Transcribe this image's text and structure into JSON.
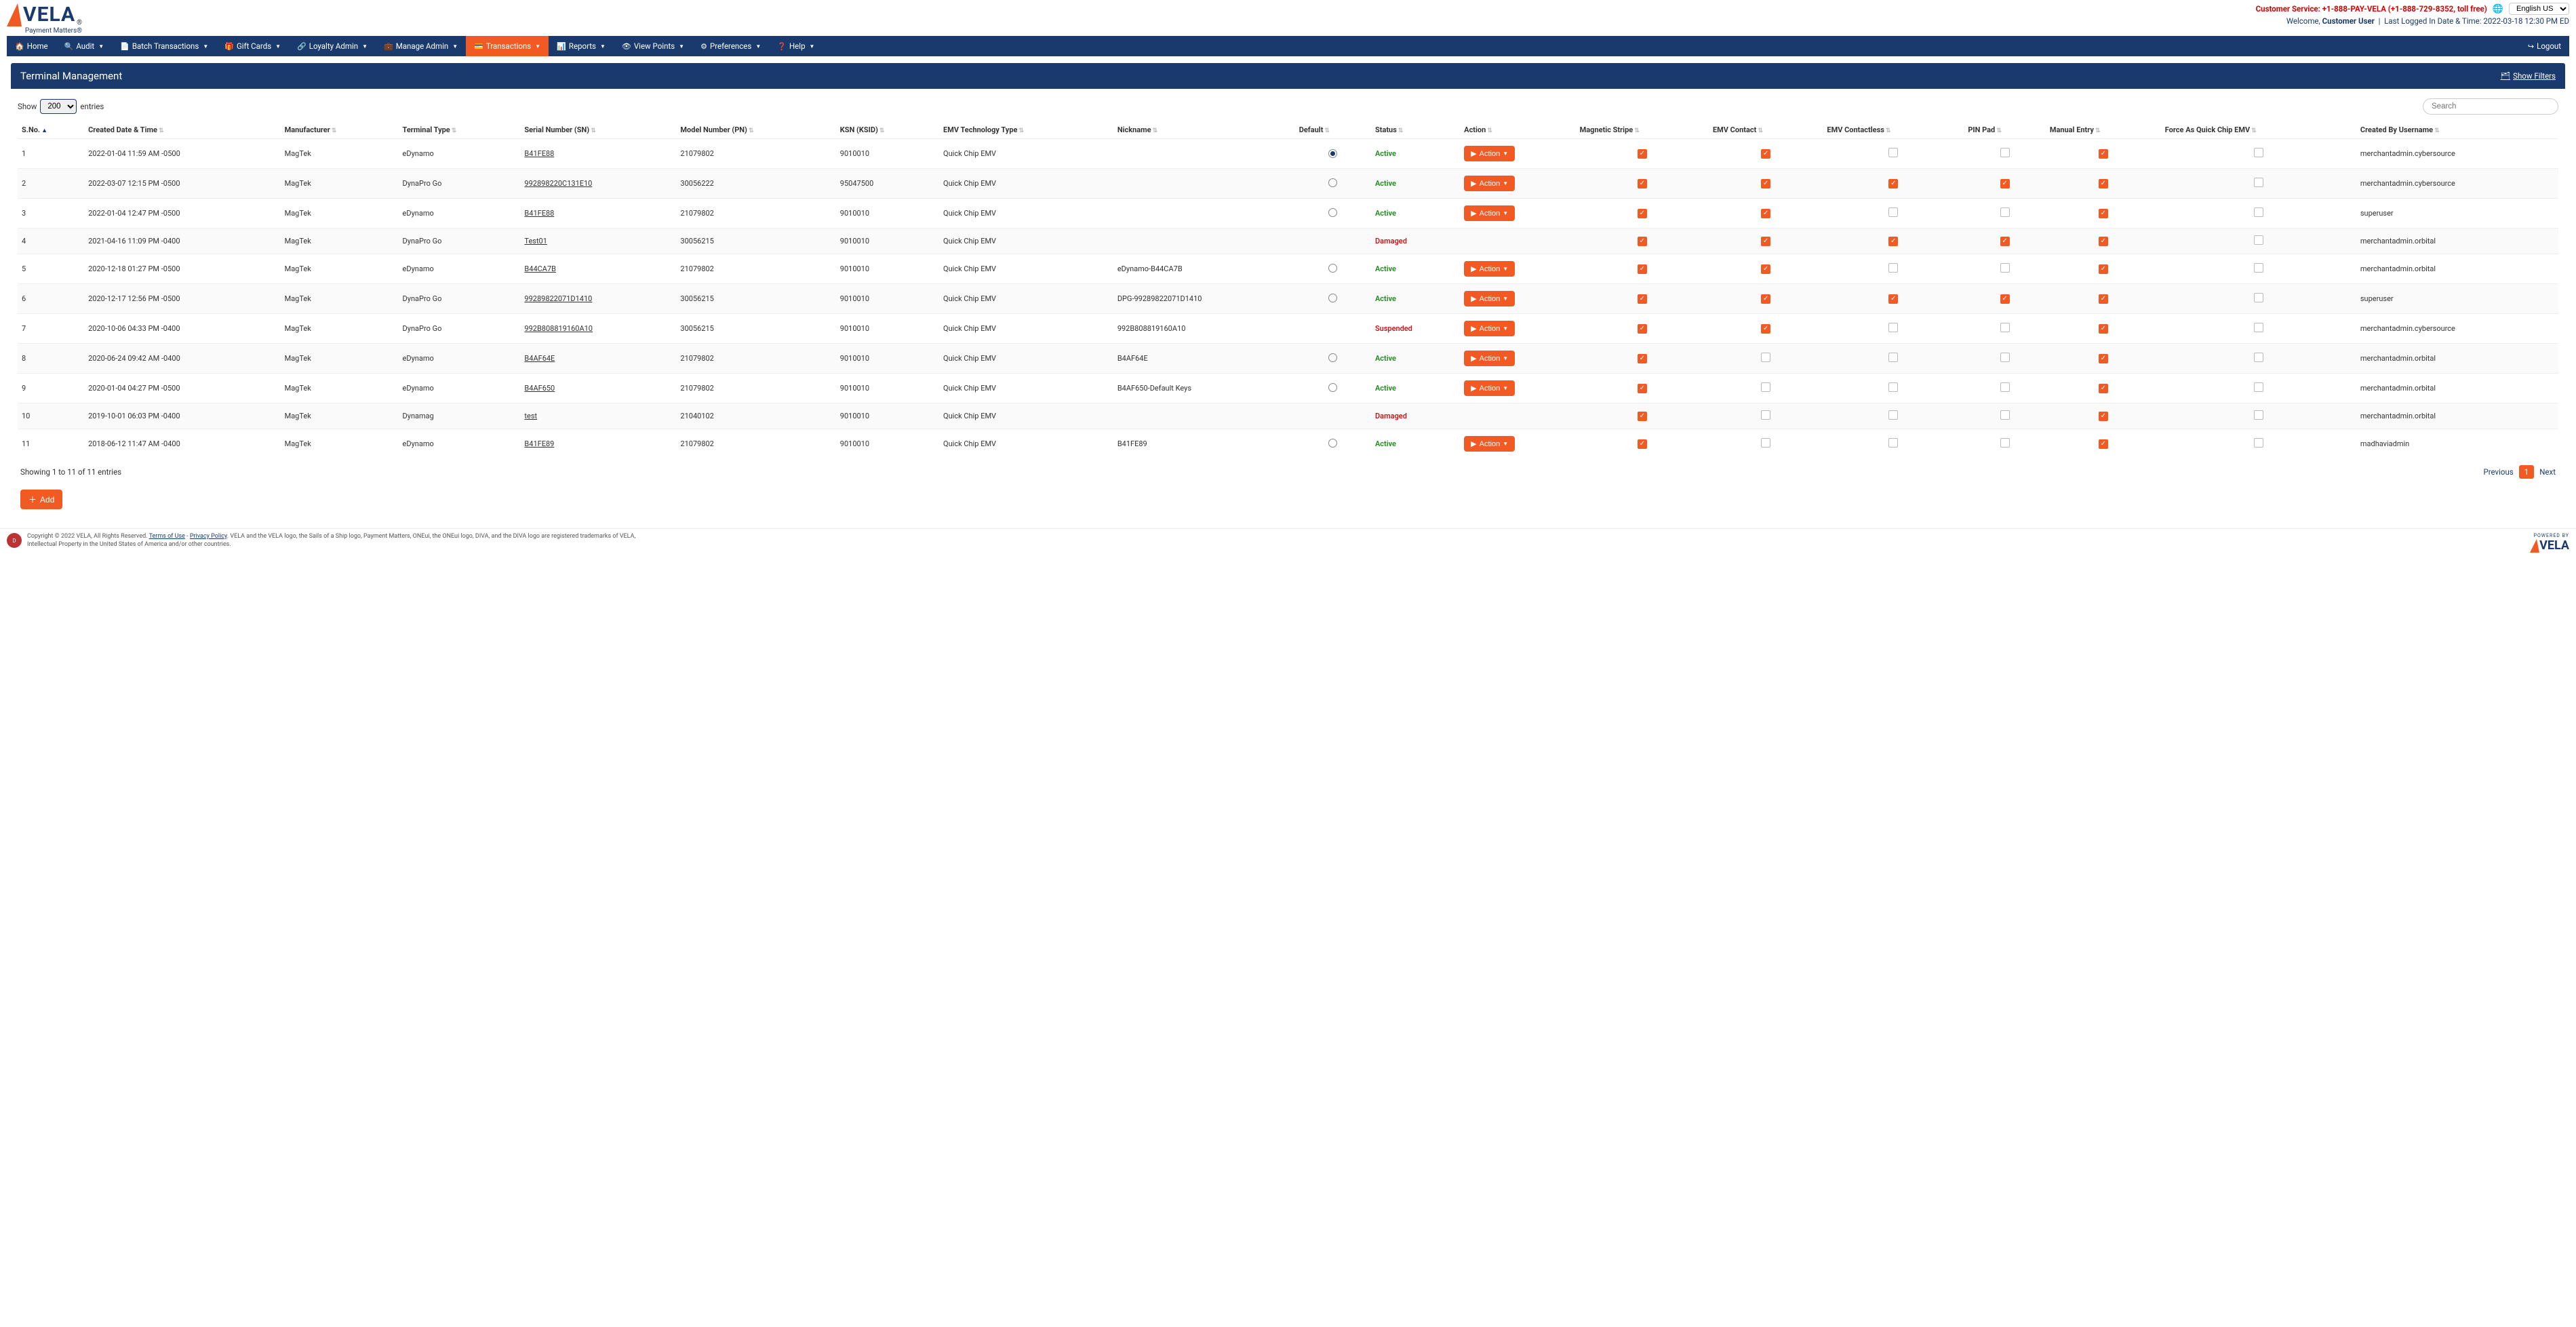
{
  "logo": {
    "text": "VELA",
    "sub": "Payment Matters®"
  },
  "header": {
    "customer_service": "Customer Service: +1-888-PAY-VELA (+1-888-729-8352, toll free)",
    "lang": "English US",
    "welcome_prefix": "Welcome, ",
    "welcome_user": "Customer User",
    "last_login_label": "Last Logged In Date & Time:",
    "last_login_value": "2022-03-18 12:30 PM ED"
  },
  "nav": {
    "items": [
      {
        "label": "Home",
        "icon": "🏠",
        "caret": false
      },
      {
        "label": "Audit",
        "icon": "🔍",
        "caret": true
      },
      {
        "label": "Batch Transactions",
        "icon": "📄",
        "caret": true
      },
      {
        "label": "Gift Cards",
        "icon": "🎁",
        "caret": true
      },
      {
        "label": "Loyalty Admin",
        "icon": "🔗",
        "caret": true
      },
      {
        "label": "Manage Admin",
        "icon": "💼",
        "caret": true
      },
      {
        "label": "Transactions",
        "icon": "💳",
        "caret": true
      },
      {
        "label": "Reports",
        "icon": "📊",
        "caret": true
      },
      {
        "label": "View Points",
        "icon": "👁",
        "caret": true
      },
      {
        "label": "Preferences",
        "icon": "⚙",
        "caret": true
      },
      {
        "label": "Help",
        "icon": "❓",
        "caret": true
      }
    ],
    "active_index": 6,
    "logout": "Logout"
  },
  "page": {
    "title": "Terminal Management",
    "show_filters": "Show Filters"
  },
  "table_ctrl": {
    "show": "Show",
    "entries_count": "200",
    "entries_label": "entries",
    "search_placeholder": "Search"
  },
  "columns": [
    "S.No.",
    "Created Date & Time",
    "Manufacturer",
    "Terminal Type",
    "Serial Number (SN)",
    "Model Number (PN)",
    "KSN (KSID)",
    "EMV Technology Type",
    "Nickname",
    "Default",
    "Status",
    "Action",
    "Magnetic Stripe",
    "EMV Contact",
    "EMV Contactless",
    "PIN Pad",
    "Manual Entry",
    "Force As Quick Chip EMV",
    "Created By Username"
  ],
  "rows": [
    {
      "sno": "1",
      "created": "2022-01-04 11:59 AM -0500",
      "manufacturer": "MagTek",
      "terminal_type": "eDynamo",
      "serial": "B41FE88",
      "model": "21079802",
      "ksn": "9010010",
      "emv_tech": "Quick Chip EMV",
      "nickname": "",
      "default": "selected",
      "status": "Active",
      "action": true,
      "mag": true,
      "emvc": true,
      "emvcl": false,
      "pin": false,
      "manual": true,
      "forceqc": false,
      "createdby": "merchantadmin.cybersource"
    },
    {
      "sno": "2",
      "created": "2022-03-07 12:15 PM -0500",
      "manufacturer": "MagTek",
      "terminal_type": "DynaPro Go",
      "serial": "992898220C131E10",
      "model": "30056222",
      "ksn": "95047500",
      "emv_tech": "Quick Chip EMV",
      "nickname": "",
      "default": "unselected",
      "status": "Active",
      "action": true,
      "mag": true,
      "emvc": true,
      "emvcl": true,
      "pin": true,
      "manual": true,
      "forceqc": false,
      "createdby": "merchantadmin.cybersource"
    },
    {
      "sno": "3",
      "created": "2022-01-04 12:47 PM -0500",
      "manufacturer": "MagTek",
      "terminal_type": "eDynamo",
      "serial": "B41FE88",
      "model": "21079802",
      "ksn": "9010010",
      "emv_tech": "Quick Chip EMV",
      "nickname": "",
      "default": "unselected",
      "status": "Active",
      "action": true,
      "mag": true,
      "emvc": true,
      "emvcl": false,
      "pin": false,
      "manual": true,
      "forceqc": false,
      "createdby": "superuser"
    },
    {
      "sno": "4",
      "created": "2021-04-16 11:09 PM -0400",
      "manufacturer": "MagTek",
      "terminal_type": "DynaPro Go",
      "serial": "Test01",
      "model": "30056215",
      "ksn": "9010010",
      "emv_tech": "Quick Chip EMV",
      "nickname": "",
      "default": "",
      "status": "Damaged",
      "action": false,
      "mag": true,
      "emvc": true,
      "emvcl": true,
      "pin": true,
      "manual": true,
      "forceqc": false,
      "createdby": "merchantadmin.orbital"
    },
    {
      "sno": "5",
      "created": "2020-12-18 01:27 PM -0500",
      "manufacturer": "MagTek",
      "terminal_type": "eDynamo",
      "serial": "B44CA7B",
      "model": "21079802",
      "ksn": "9010010",
      "emv_tech": "Quick Chip EMV",
      "nickname": "eDynamo-B44CA7B",
      "default": "unselected",
      "status": "Active",
      "action": true,
      "mag": true,
      "emvc": true,
      "emvcl": false,
      "pin": false,
      "manual": true,
      "forceqc": false,
      "createdby": "merchantadmin.orbital"
    },
    {
      "sno": "6",
      "created": "2020-12-17 12:56 PM -0500",
      "manufacturer": "MagTek",
      "terminal_type": "DynaPro Go",
      "serial": "99289822071D1410",
      "model": "30056215",
      "ksn": "9010010",
      "emv_tech": "Quick Chip EMV",
      "nickname": "DPG-99289822071D1410",
      "default": "unselected",
      "status": "Active",
      "action": true,
      "mag": true,
      "emvc": true,
      "emvcl": true,
      "pin": true,
      "manual": true,
      "forceqc": false,
      "createdby": "superuser"
    },
    {
      "sno": "7",
      "created": "2020-10-06 04:33 PM -0400",
      "manufacturer": "MagTek",
      "terminal_type": "DynaPro Go",
      "serial": "992B808819160A10",
      "model": "30056215",
      "ksn": "9010010",
      "emv_tech": "Quick Chip EMV",
      "nickname": "992B808819160A10",
      "default": "",
      "status": "Suspended",
      "action": true,
      "mag": true,
      "emvc": true,
      "emvcl": false,
      "pin": false,
      "manual": true,
      "forceqc": false,
      "createdby": "merchantadmin.cybersource"
    },
    {
      "sno": "8",
      "created": "2020-06-24 09:42 AM -0400",
      "manufacturer": "MagTek",
      "terminal_type": "eDynamo",
      "serial": "B4AF64E",
      "model": "21079802",
      "ksn": "9010010",
      "emv_tech": "Quick Chip EMV",
      "nickname": "B4AF64E",
      "default": "unselected",
      "status": "Active",
      "action": true,
      "mag": true,
      "emvc": false,
      "emvcl": false,
      "pin": false,
      "manual": true,
      "forceqc": false,
      "createdby": "merchantadmin.orbital"
    },
    {
      "sno": "9",
      "created": "2020-01-04 04:27 PM -0500",
      "manufacturer": "MagTek",
      "terminal_type": "eDynamo",
      "serial": "B4AF650",
      "model": "21079802",
      "ksn": "9010010",
      "emv_tech": "Quick Chip EMV",
      "nickname": "B4AF650-Default Keys",
      "default": "unselected",
      "status": "Active",
      "action": true,
      "mag": true,
      "emvc": false,
      "emvcl": false,
      "pin": false,
      "manual": true,
      "forceqc": false,
      "createdby": "merchantadmin.orbital"
    },
    {
      "sno": "10",
      "created": "2019-10-01 06:03 PM -0400",
      "manufacturer": "MagTek",
      "terminal_type": "Dynamag",
      "serial": "test",
      "model": "21040102",
      "ksn": "9010010",
      "emv_tech": "Quick Chip EMV",
      "nickname": "",
      "default": "",
      "status": "Damaged",
      "action": false,
      "mag": true,
      "emvc": false,
      "emvcl": false,
      "pin": false,
      "manual": true,
      "forceqc": false,
      "createdby": "merchantadmin.orbital"
    },
    {
      "sno": "11",
      "created": "2018-06-12 11:47 AM -0400",
      "manufacturer": "MagTek",
      "terminal_type": "eDynamo",
      "serial": "B41FE89",
      "model": "21079802",
      "ksn": "9010010",
      "emv_tech": "Quick Chip EMV",
      "nickname": "B41FE89",
      "default": "unselected",
      "status": "Active",
      "action": true,
      "mag": true,
      "emvc": false,
      "emvcl": false,
      "pin": false,
      "manual": true,
      "forceqc": false,
      "createdby": "madhaviadmin"
    }
  ],
  "action_label": "Action",
  "bottom": {
    "info": "Showing 1 to 11 of 11 entries",
    "previous": "Previous",
    "page": "1",
    "next": "Next",
    "add": "Add"
  },
  "footer": {
    "copyright_prefix": "Copyright © 2022 VELA, All Rights Reserved. ",
    "terms": "Terms of Use",
    "sep": " - ",
    "privacy": "Privacy Policy",
    "copyright_rest": ". VELA and the VELA logo, the Sails of a Ship logo, Payment Matters, ONEui, the ONEui logo, DIVA, and the DIVA logo are registered trademarks of VELA, Intellectual Property in the United States of America and/or other countries.",
    "powered_by": "POWERED BY",
    "brand": "VELA"
  }
}
